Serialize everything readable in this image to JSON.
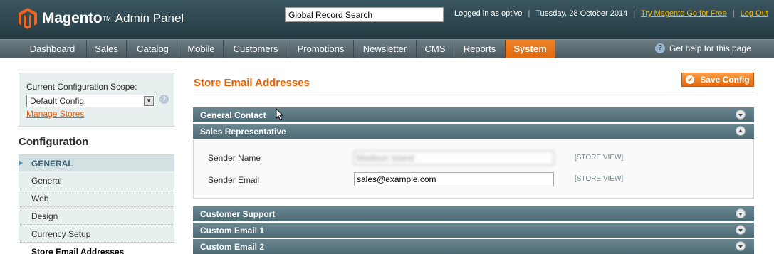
{
  "header": {
    "logo_word": "Magento",
    "logo_tm": "TM",
    "logo_sub": "Admin Panel",
    "search_value": "Global Record Search",
    "logged_in": "Logged in as optivo",
    "date": "Tuesday, 28 October 2014",
    "try_link": "Try Magento Go for Free",
    "logout_link": "Log Out",
    "separator": "|"
  },
  "nav": {
    "items": [
      {
        "label": "Dashboard"
      },
      {
        "label": "Sales"
      },
      {
        "label": "Catalog"
      },
      {
        "label": "Mobile"
      },
      {
        "label": "Customers"
      },
      {
        "label": "Promotions"
      },
      {
        "label": "Newsletter"
      },
      {
        "label": "CMS"
      },
      {
        "label": "Reports"
      },
      {
        "label": "System"
      }
    ],
    "active": "System",
    "help_text": "Get help for this page"
  },
  "sidebar": {
    "scope_label": "Current Configuration Scope:",
    "scope_value": "Default Config",
    "manage_stores": "Manage Stores",
    "config_title": "Configuration",
    "group_label": "GENERAL",
    "items": [
      {
        "label": "General"
      },
      {
        "label": "Web"
      },
      {
        "label": "Design"
      },
      {
        "label": "Currency Setup"
      },
      {
        "label": "Store Email Addresses"
      }
    ]
  },
  "main": {
    "page_title": "Store Email Addresses",
    "save_button": "Save Config",
    "sections": [
      {
        "title": "General Contact",
        "state": "collapsed"
      },
      {
        "title": "Sales Representative",
        "state": "expanded"
      },
      {
        "title": "Customer Support",
        "state": "collapsed"
      },
      {
        "title": "Custom Email 1",
        "state": "collapsed"
      },
      {
        "title": "Custom Email 2",
        "state": "collapsed"
      }
    ],
    "fields": [
      {
        "label": "Sender Name",
        "value": "Madison Island",
        "scope": "[STORE VIEW]"
      },
      {
        "label": "Sender Email",
        "value": "sales@example.com",
        "scope": "[STORE VIEW]"
      }
    ]
  },
  "colors": {
    "accent": "#eb5e00",
    "header_bg": "#2f4a53",
    "nav_active": "#eb7a1f",
    "section_header": "#5e7a84"
  }
}
